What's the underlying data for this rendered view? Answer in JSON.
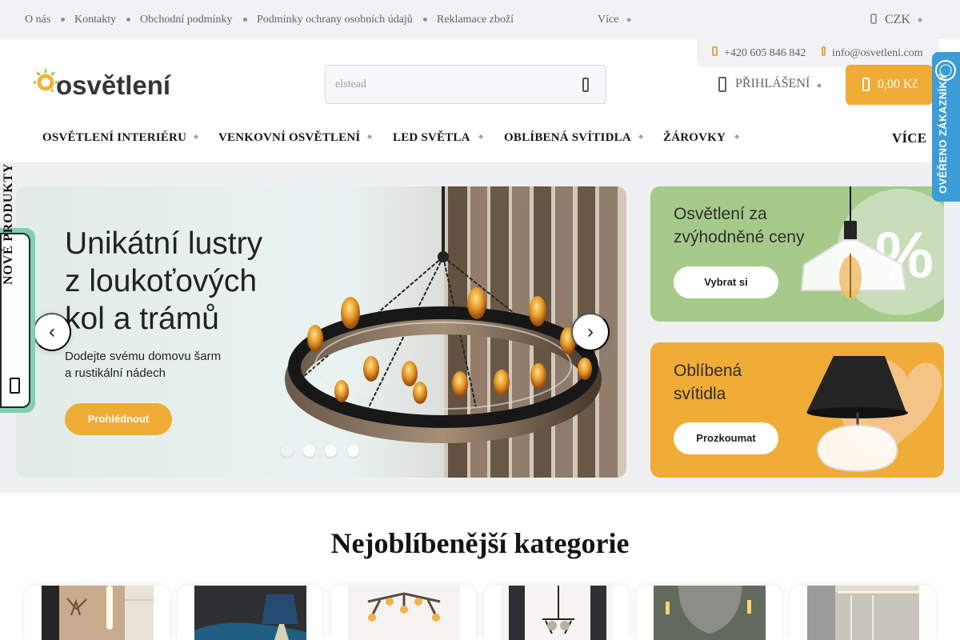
{
  "topbar": {
    "links": [
      "O nás",
      "Kontakty",
      "Obchodní podmínky",
      "Podmínky ochrany osobních údajů",
      "Reklamace zboží"
    ],
    "more": "Více",
    "currency": "CZK"
  },
  "contact": {
    "phone": "+420 605 846 842",
    "email": "info@osvetleni.com"
  },
  "header": {
    "logo_text": "osvětlení",
    "search_placeholder": "elstead",
    "login_label": "PŘIHLÁŠENÍ",
    "cart_total": "0,00 Kč"
  },
  "navigation": {
    "items": [
      "OSVĚTLENÍ INTERIÉRU",
      "VENKOVNÍ OSVĚTLENÍ",
      "LED SVĚTLA",
      "OBLÍBENÁ SVÍTIDLA",
      "ŽÁROVKY"
    ],
    "more": "VÍCE"
  },
  "hero": {
    "title_lines": [
      "Unikátní lustry",
      "z loukoťových",
      "kol a trámů"
    ],
    "subtitle_lines": [
      "Dodejte svému domovu šarm",
      "a rustikální nádech"
    ],
    "button_label": "Prohlédnout",
    "slides_count": 4,
    "active_slide": 1
  },
  "side_tabs": {
    "new_products": "NOVÉ PRODUKTY",
    "verified": "OVĚŘENO ZÁKAZNÍKY"
  },
  "promos": [
    {
      "title_lines": [
        "Osvětlení za",
        "zvýhodněné ceny"
      ],
      "button_label": "Vybrat si",
      "badge": "%"
    },
    {
      "title_lines": [
        "Oblíbená",
        "svítidla"
      ],
      "button_label": "Prozkoumat"
    }
  ],
  "categories": {
    "title": "Nejoblíbenější kategorie",
    "items": [
      "category-1",
      "category-2",
      "category-3",
      "category-4",
      "category-5",
      "category-6"
    ]
  },
  "colors": {
    "accent": "#efac37",
    "green_promo": "#a6ca8a",
    "new_tab": "#7ed0ae",
    "verified": "#3c9cd7"
  }
}
